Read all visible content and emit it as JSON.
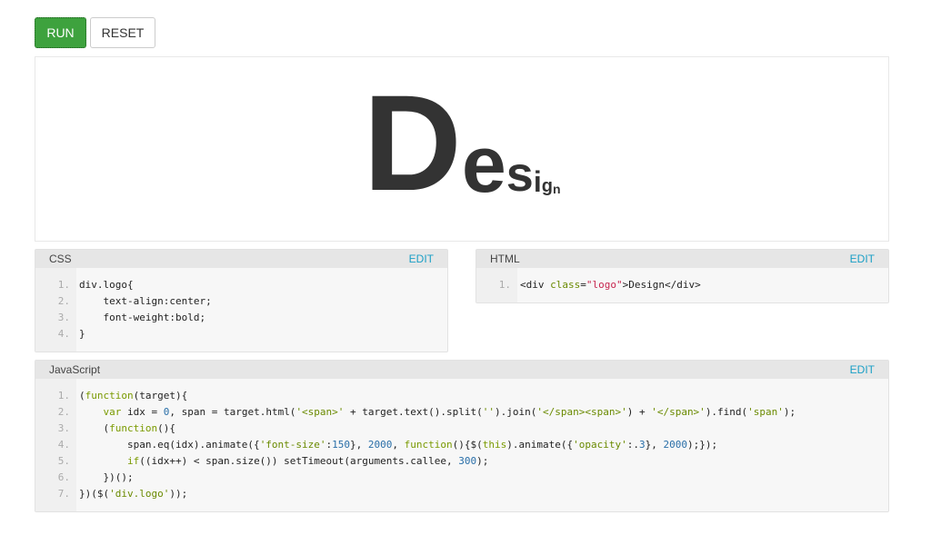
{
  "toolbar": {
    "run_label": "RUN",
    "reset_label": "RESET"
  },
  "result": {
    "letters": [
      {
        "char": "D",
        "font_size": 150
      },
      {
        "char": "e",
        "font_size": 88
      },
      {
        "char": "s",
        "font_size": 54
      },
      {
        "char": "i",
        "font_size": 32
      },
      {
        "char": "g",
        "font_size": 20
      },
      {
        "char": "n",
        "font_size": 14
      }
    ]
  },
  "css_panel": {
    "title": "CSS",
    "edit_label": "EDIT",
    "lines": [
      {
        "num": "1.",
        "html": "div.logo{"
      },
      {
        "num": "2.",
        "html": "    text-align:center;"
      },
      {
        "num": "3.",
        "html": "    font-weight:bold;"
      },
      {
        "num": "4.",
        "html": "}"
      }
    ]
  },
  "html_panel": {
    "title": "HTML",
    "edit_label": "EDIT",
    "lines": [
      {
        "num": "1.",
        "html": "&lt;div <span class=\"a\">class</span>=<span class=\"t\">\"logo\"</span>&gt;Design&lt;/div&gt;"
      }
    ]
  },
  "js_panel": {
    "title": "JavaScript",
    "edit_label": "EDIT",
    "lines": [
      {
        "num": "1.",
        "html": "(<span class=\"k\">function</span>(target){"
      },
      {
        "num": "2.",
        "html": "    <span class=\"k\">var</span> idx = <span class=\"n\">0</span>, span = target.html(<span class=\"s\">'&lt;span&gt;'</span> + target.text().split(<span class=\"s\">''</span>).join(<span class=\"s\">'&lt;/span&gt;&lt;span&gt;'</span>) + <span class=\"s\">'&lt;/span&gt;'</span>).find(<span class=\"s\">'span'</span>);"
      },
      {
        "num": "3.",
        "html": "    (<span class=\"k\">function</span>(){"
      },
      {
        "num": "4.",
        "html": "        span.eq(idx).animate({<span class=\"s\">'font-size'</span>:<span class=\"n\">150</span>}, <span class=\"n\">2000</span>, <span class=\"k\">function</span>(){$(<span class=\"k\">this</span>).animate({<span class=\"s\">'opacity'</span>:.<span class=\"n\">3</span>}, <span class=\"n\">2000</span>);});"
      },
      {
        "num": "5.",
        "html": "        <span class=\"k\">if</span>((idx++) &lt; span.size()) setTimeout(arguments.callee, <span class=\"n\">300</span>);"
      },
      {
        "num": "6.",
        "html": "    })();"
      },
      {
        "num": "7.",
        "html": "})($(<span class=\"s\">'div.logo'</span>));"
      }
    ]
  },
  "colors": {
    "run_button": "#3ea23e",
    "edit_link": "#1a9fc6",
    "panel_header": "#e6e6e6",
    "panel_body": "#f7f7f7"
  }
}
